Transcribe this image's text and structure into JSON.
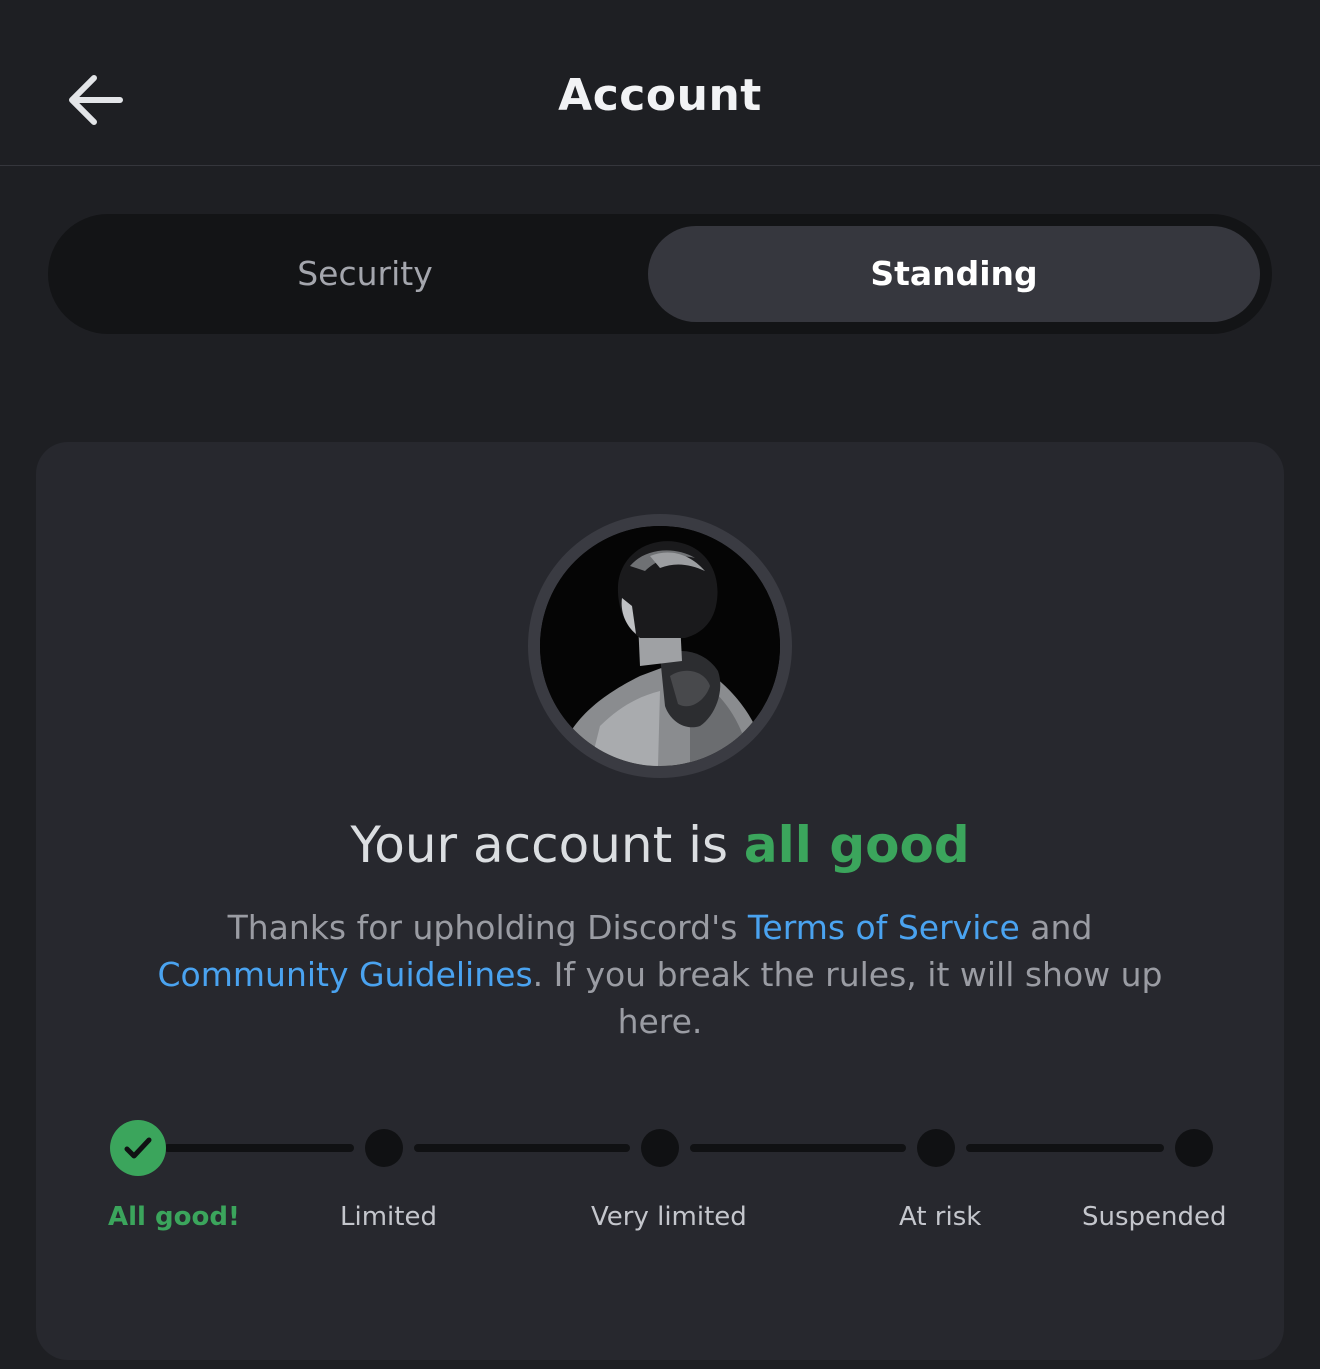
{
  "header": {
    "title": "Account",
    "back_icon": "arrow-left-icon"
  },
  "tabs": [
    {
      "label": "Security",
      "selected": false
    },
    {
      "label": "Standing",
      "selected": true
    }
  ],
  "standing": {
    "avatar_icon": "user-avatar",
    "headline_prefix": "Your account is ",
    "headline_status": "all good",
    "description": {
      "part1": "Thanks for upholding Discord's ",
      "tos_link": "Terms of Service",
      "part2": " and ",
      "guidelines_link": "Community Guidelines",
      "part3": ". If you break the rules, it will show up here."
    },
    "levels": [
      {
        "label": "All good!",
        "active": true
      },
      {
        "label": "Limited",
        "active": false
      },
      {
        "label": "Very limited",
        "active": false
      },
      {
        "label": "At risk",
        "active": false
      },
      {
        "label": "Suspended",
        "active": false
      }
    ],
    "current_level_index": 0
  },
  "colors": {
    "background": "#1e1f23",
    "card": "#27282e",
    "accent_green": "#3ba55c",
    "link_blue": "#4aa3f0"
  }
}
